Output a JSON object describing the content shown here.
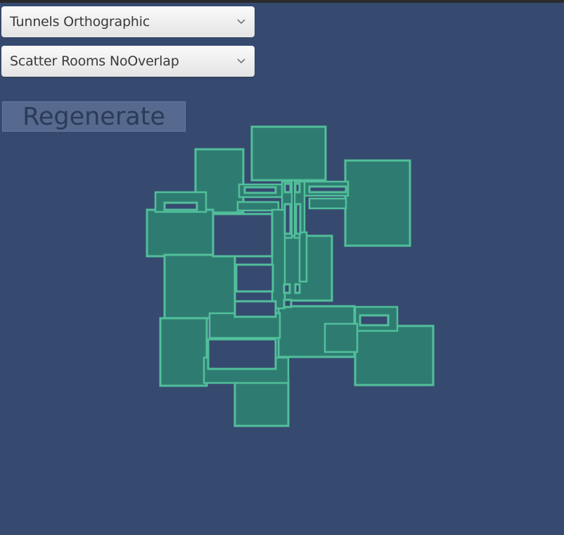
{
  "dropdown_tunnels": {
    "selected": "Tunnels Orthographic",
    "icon": "chevron-down-icon"
  },
  "dropdown_rooms": {
    "selected": "Scatter Rooms NoOverlap",
    "icon": "chevron-down-icon"
  },
  "regenerate_button": {
    "label": "Regenerate"
  },
  "colors": {
    "background": "#364a6f",
    "room_fill": "#2e7c71",
    "room_outline": "#52bf9b",
    "button_bg": "#56698e",
    "button_text": "#2b3b58"
  }
}
